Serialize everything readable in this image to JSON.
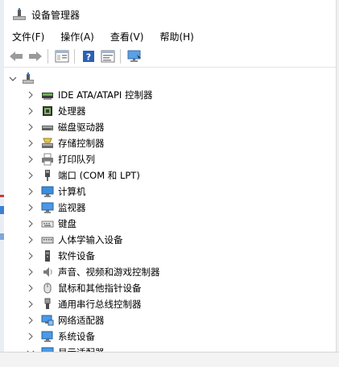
{
  "window": {
    "title": "设备管理器"
  },
  "menu": [
    "文件(F)",
    "操作(A)",
    "查看(V)",
    "帮助(H)"
  ],
  "toolbar": {
    "buttons": [
      "back-arrow-icon",
      "forward-arrow-icon",
      "properties-icon",
      "help-icon",
      "update-driver-icon",
      "scan-hardware-icon"
    ]
  },
  "tree": {
    "root_icon": "computer-root-icon",
    "items": [
      {
        "label": "IDE ATA/ATAPI 控制器",
        "icon": "ide-controller-icon"
      },
      {
        "label": "处理器",
        "icon": "processor-icon"
      },
      {
        "label": "磁盘驱动器",
        "icon": "disk-drive-icon"
      },
      {
        "label": "存储控制器",
        "icon": "storage-controller-icon"
      },
      {
        "label": "打印队列",
        "icon": "printer-icon"
      },
      {
        "label": "端口 (COM 和 LPT)",
        "icon": "port-icon"
      },
      {
        "label": "计算机",
        "icon": "computer-icon"
      },
      {
        "label": "监视器",
        "icon": "monitor-icon"
      },
      {
        "label": "键盘",
        "icon": "keyboard-icon"
      },
      {
        "label": "人体学输入设备",
        "icon": "hid-icon"
      },
      {
        "label": "软件设备",
        "icon": "software-device-icon"
      },
      {
        "label": "声音、视频和游戏控制器",
        "icon": "audio-icon"
      },
      {
        "label": "鼠标和其他指针设备",
        "icon": "mouse-icon"
      },
      {
        "label": "通用串行总线控制器",
        "icon": "usb-icon"
      },
      {
        "label": "网络适配器",
        "icon": "network-adapter-icon"
      },
      {
        "label": "系统设备",
        "icon": "system-device-icon"
      },
      {
        "label": "显示适配器",
        "icon": "display-adapter-icon"
      }
    ]
  },
  "colors": {
    "accent_blue": "#3c7fd6",
    "help_blue": "#2b5fb4",
    "edge_red": "#d33a3a"
  }
}
